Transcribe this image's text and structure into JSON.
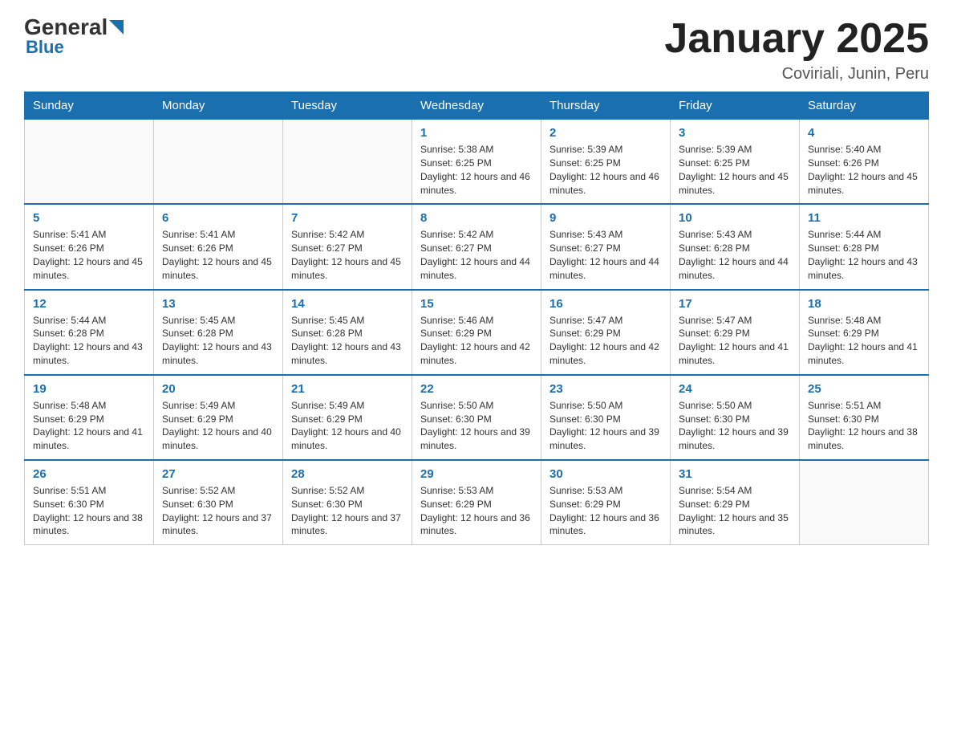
{
  "header": {
    "logo_general": "General",
    "logo_blue": "Blue",
    "title": "January 2025",
    "subtitle": "Coviriali, Junin, Peru"
  },
  "days_of_week": [
    "Sunday",
    "Monday",
    "Tuesday",
    "Wednesday",
    "Thursday",
    "Friday",
    "Saturday"
  ],
  "weeks": [
    [
      {
        "day": "",
        "info": ""
      },
      {
        "day": "",
        "info": ""
      },
      {
        "day": "",
        "info": ""
      },
      {
        "day": "1",
        "info": "Sunrise: 5:38 AM\nSunset: 6:25 PM\nDaylight: 12 hours and 46 minutes."
      },
      {
        "day": "2",
        "info": "Sunrise: 5:39 AM\nSunset: 6:25 PM\nDaylight: 12 hours and 46 minutes."
      },
      {
        "day": "3",
        "info": "Sunrise: 5:39 AM\nSunset: 6:25 PM\nDaylight: 12 hours and 45 minutes."
      },
      {
        "day": "4",
        "info": "Sunrise: 5:40 AM\nSunset: 6:26 PM\nDaylight: 12 hours and 45 minutes."
      }
    ],
    [
      {
        "day": "5",
        "info": "Sunrise: 5:41 AM\nSunset: 6:26 PM\nDaylight: 12 hours and 45 minutes."
      },
      {
        "day": "6",
        "info": "Sunrise: 5:41 AM\nSunset: 6:26 PM\nDaylight: 12 hours and 45 minutes."
      },
      {
        "day": "7",
        "info": "Sunrise: 5:42 AM\nSunset: 6:27 PM\nDaylight: 12 hours and 45 minutes."
      },
      {
        "day": "8",
        "info": "Sunrise: 5:42 AM\nSunset: 6:27 PM\nDaylight: 12 hours and 44 minutes."
      },
      {
        "day": "9",
        "info": "Sunrise: 5:43 AM\nSunset: 6:27 PM\nDaylight: 12 hours and 44 minutes."
      },
      {
        "day": "10",
        "info": "Sunrise: 5:43 AM\nSunset: 6:28 PM\nDaylight: 12 hours and 44 minutes."
      },
      {
        "day": "11",
        "info": "Sunrise: 5:44 AM\nSunset: 6:28 PM\nDaylight: 12 hours and 43 minutes."
      }
    ],
    [
      {
        "day": "12",
        "info": "Sunrise: 5:44 AM\nSunset: 6:28 PM\nDaylight: 12 hours and 43 minutes."
      },
      {
        "day": "13",
        "info": "Sunrise: 5:45 AM\nSunset: 6:28 PM\nDaylight: 12 hours and 43 minutes."
      },
      {
        "day": "14",
        "info": "Sunrise: 5:45 AM\nSunset: 6:28 PM\nDaylight: 12 hours and 43 minutes."
      },
      {
        "day": "15",
        "info": "Sunrise: 5:46 AM\nSunset: 6:29 PM\nDaylight: 12 hours and 42 minutes."
      },
      {
        "day": "16",
        "info": "Sunrise: 5:47 AM\nSunset: 6:29 PM\nDaylight: 12 hours and 42 minutes."
      },
      {
        "day": "17",
        "info": "Sunrise: 5:47 AM\nSunset: 6:29 PM\nDaylight: 12 hours and 41 minutes."
      },
      {
        "day": "18",
        "info": "Sunrise: 5:48 AM\nSunset: 6:29 PM\nDaylight: 12 hours and 41 minutes."
      }
    ],
    [
      {
        "day": "19",
        "info": "Sunrise: 5:48 AM\nSunset: 6:29 PM\nDaylight: 12 hours and 41 minutes."
      },
      {
        "day": "20",
        "info": "Sunrise: 5:49 AM\nSunset: 6:29 PM\nDaylight: 12 hours and 40 minutes."
      },
      {
        "day": "21",
        "info": "Sunrise: 5:49 AM\nSunset: 6:29 PM\nDaylight: 12 hours and 40 minutes."
      },
      {
        "day": "22",
        "info": "Sunrise: 5:50 AM\nSunset: 6:30 PM\nDaylight: 12 hours and 39 minutes."
      },
      {
        "day": "23",
        "info": "Sunrise: 5:50 AM\nSunset: 6:30 PM\nDaylight: 12 hours and 39 minutes."
      },
      {
        "day": "24",
        "info": "Sunrise: 5:50 AM\nSunset: 6:30 PM\nDaylight: 12 hours and 39 minutes."
      },
      {
        "day": "25",
        "info": "Sunrise: 5:51 AM\nSunset: 6:30 PM\nDaylight: 12 hours and 38 minutes."
      }
    ],
    [
      {
        "day": "26",
        "info": "Sunrise: 5:51 AM\nSunset: 6:30 PM\nDaylight: 12 hours and 38 minutes."
      },
      {
        "day": "27",
        "info": "Sunrise: 5:52 AM\nSunset: 6:30 PM\nDaylight: 12 hours and 37 minutes."
      },
      {
        "day": "28",
        "info": "Sunrise: 5:52 AM\nSunset: 6:30 PM\nDaylight: 12 hours and 37 minutes."
      },
      {
        "day": "29",
        "info": "Sunrise: 5:53 AM\nSunset: 6:29 PM\nDaylight: 12 hours and 36 minutes."
      },
      {
        "day": "30",
        "info": "Sunrise: 5:53 AM\nSunset: 6:29 PM\nDaylight: 12 hours and 36 minutes."
      },
      {
        "day": "31",
        "info": "Sunrise: 5:54 AM\nSunset: 6:29 PM\nDaylight: 12 hours and 35 minutes."
      },
      {
        "day": "",
        "info": ""
      }
    ]
  ]
}
